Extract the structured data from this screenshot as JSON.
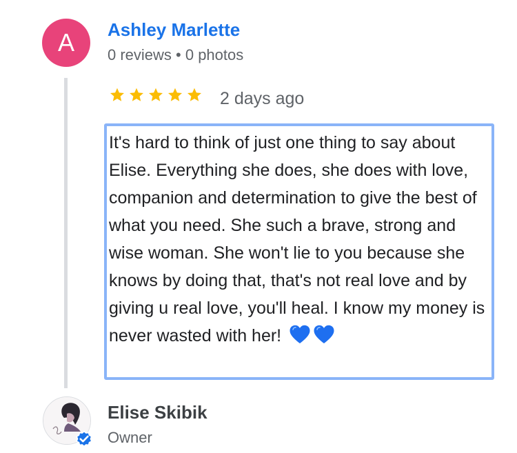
{
  "reviewer": {
    "initial": "A",
    "name": "Ashley Marlette",
    "meta": "0 reviews • 0 photos"
  },
  "review": {
    "rating": 5,
    "time": "2 days ago",
    "text": "It's hard to think of just one thing to say about Elise. Everything she does, she does with love, companion and determination to give the best of what you need. She such a brave, strong and wise woman. She won't lie to you because she knows by doing that, that's not real love and by giving u real love, you'll heal. I know my money is never wasted with her!",
    "emoji": [
      "blue-heart-icon",
      "blue-heart-icon"
    ]
  },
  "owner": {
    "name": "Elise Skibik",
    "role": "Owner",
    "badge_icon": "verified-check-icon"
  },
  "colors": {
    "avatar_bg": "#e8437a",
    "name_link": "#1a73e8",
    "star": "#fbbc04",
    "selection_border": "#8ab4f8",
    "heart": "#1e6ff0",
    "verified_badge": "#1a73e8"
  }
}
